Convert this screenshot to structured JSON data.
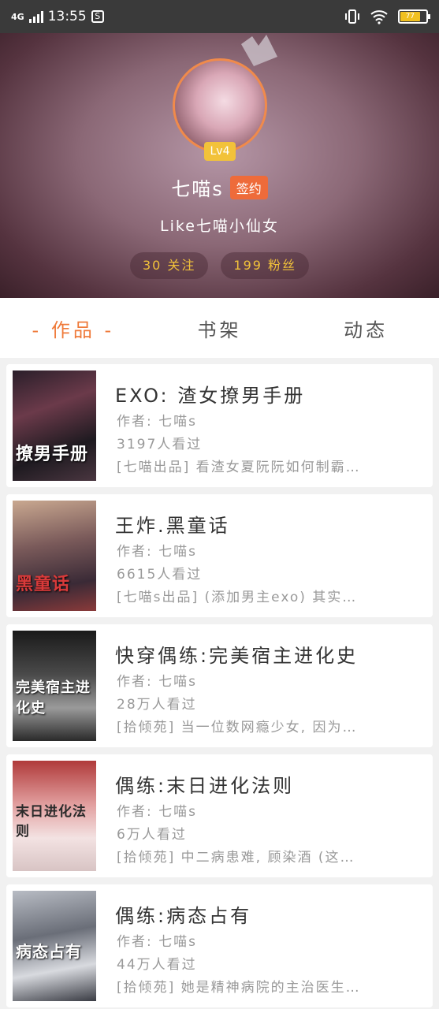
{
  "status_bar": {
    "network": "4G",
    "time": "13:55",
    "battery_text": "77"
  },
  "profile": {
    "level": "Lv4",
    "username": "七喵s",
    "signed_badge": "签约",
    "bio": "Like七喵小仙女",
    "following": "30 关注",
    "followers": "199 粉丝"
  },
  "tabs": [
    {
      "label": "- 作品 -",
      "active": true
    },
    {
      "label": "书架",
      "active": false
    },
    {
      "label": "动态",
      "active": false
    }
  ],
  "books": [
    {
      "cover_text": "撩男手册",
      "title": "EXO: 渣女撩男手册",
      "author": "作者: 七喵s",
      "views": "3197人看过",
      "desc": "[七喵出品] 看渣女夏阮阮如何制霸…"
    },
    {
      "cover_text": "黑童话",
      "title": "王炸.黑童话",
      "author": "作者: 七喵s",
      "views": "6615人看过",
      "desc": "[七喵s出品] (添加男主exo) 其实…"
    },
    {
      "cover_text": "完美宿主进化史",
      "title": "快穿偶练:完美宿主进化史",
      "author": "作者: 七喵s",
      "views": "28万人看过",
      "desc": "[拾倾苑] 当一位数网瘾少女, 因为…"
    },
    {
      "cover_text": "末日进化法则",
      "title": "偶练:末日进化法则",
      "author": "作者: 七喵s",
      "views": "6万人看过",
      "desc": "[拾倾苑] 中二病患难, 顾染酒 (这…"
    },
    {
      "cover_text": "病态占有",
      "title": "偶练:病态占有",
      "author": "作者: 七喵s",
      "views": "44万人看过",
      "desc": "[拾倾苑] 她是精神病院的主治医生…"
    }
  ]
}
